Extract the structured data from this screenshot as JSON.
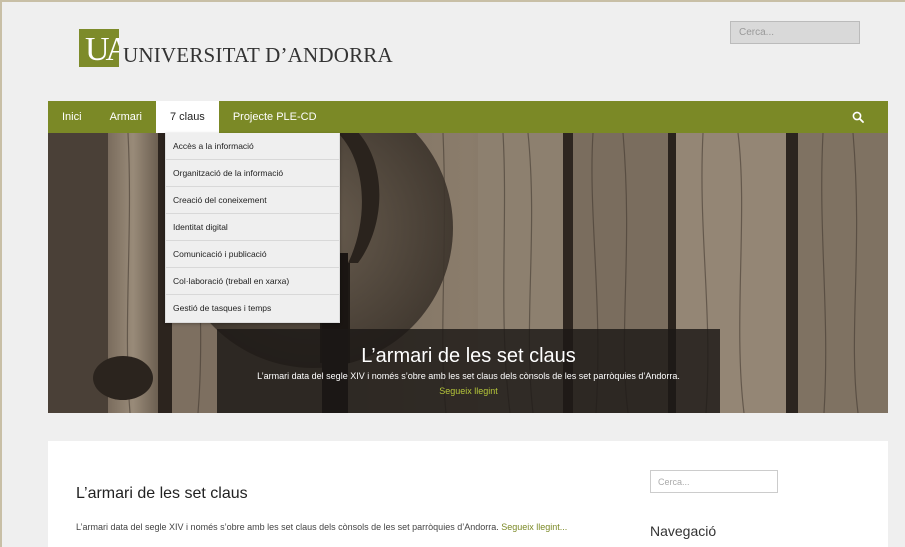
{
  "header": {
    "logo_mark": "UA",
    "site_name": "UNIVERSITAT D’ANDORRA",
    "search_placeholder": "Cerca..."
  },
  "nav": {
    "items": [
      {
        "label": "Inici"
      },
      {
        "label": "Armari"
      },
      {
        "label": "7 claus"
      },
      {
        "label": "Projecte PLE-CD"
      }
    ],
    "active_index": 2,
    "search_icon": "search-icon"
  },
  "dropdown": {
    "items": [
      {
        "label": "Accès a la informació"
      },
      {
        "label": "Organització de la informació"
      },
      {
        "label": "Creació del coneixement"
      },
      {
        "label": "Identitat digital"
      },
      {
        "label": "Comunicació i publicació"
      },
      {
        "label": "Col·laboració (treball en xarxa)"
      },
      {
        "label": "Gestió de tasques i temps"
      }
    ]
  },
  "hero": {
    "title": "L’armari de les set claus",
    "text": "L’armari data del segle XIV i només s’obre amb les set claus dels cònsols de les set parròquies d’Andorra.",
    "link": "Segueix llegint"
  },
  "post": {
    "title": "L’armari de les set claus",
    "excerpt": "L’armari data del segle XIV i només s’obre amb les set claus dels cònsols de les set parròquies d’Andorra.",
    "more": "Segueix llegint..."
  },
  "sidebar": {
    "search_placeholder": "Cerca...",
    "heading": "Navegació"
  },
  "colors": {
    "brand_green": "#7b8926",
    "link_green": "#b5c53a",
    "background": "#efefef"
  }
}
